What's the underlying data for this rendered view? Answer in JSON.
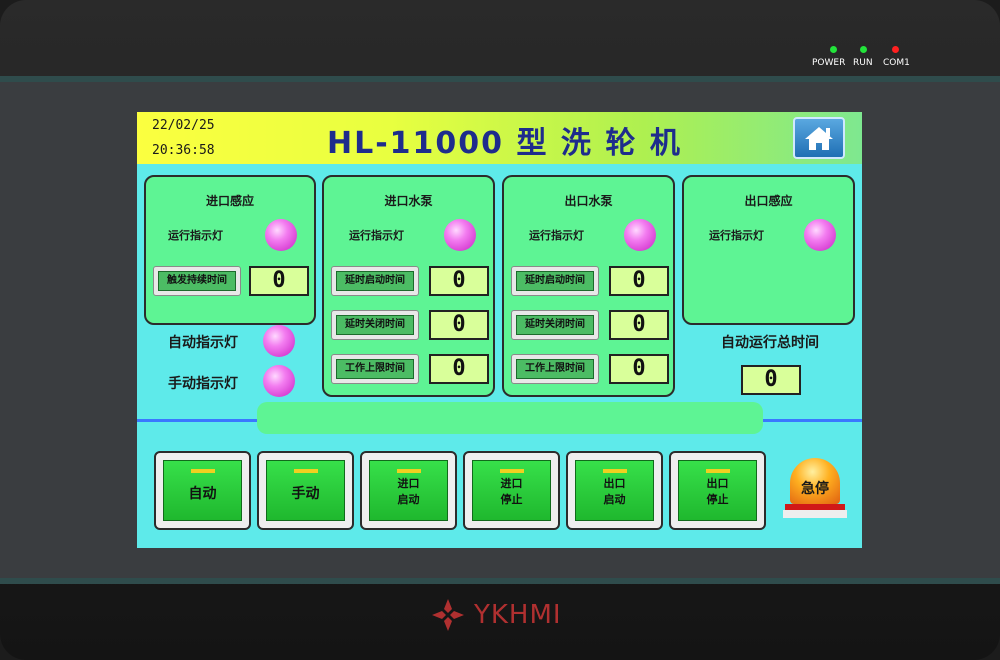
{
  "device": {
    "leds": [
      {
        "label": "POWER",
        "color": "#22e33a"
      },
      {
        "label": "RUN",
        "color": "#22e33a"
      },
      {
        "label": "COM1",
        "color": "#ff2020"
      }
    ],
    "brand": "YKHMI"
  },
  "header": {
    "date": "22/02/25",
    "time": "20:36:58",
    "title": "HL-11000 型 洗 轮 机"
  },
  "panels": [
    {
      "title": "进口感应",
      "lamp_label": "运行指示灯",
      "params": [
        {
          "label": "触发持续时间",
          "value": "0"
        }
      ]
    },
    {
      "title": "进口水泵",
      "lamp_label": "运行指示灯",
      "params": [
        {
          "label": "延时启动时间",
          "value": "0"
        },
        {
          "label": "延时关闭时间",
          "value": "0"
        },
        {
          "label": "工作上限时间",
          "value": "0"
        }
      ]
    },
    {
      "title": "出口水泵",
      "lamp_label": "运行指示灯",
      "params": [
        {
          "label": "延时启动时间",
          "value": "0"
        },
        {
          "label": "延时关闭时间",
          "value": "0"
        },
        {
          "label": "工作上限时间",
          "value": "0"
        }
      ]
    },
    {
      "title": "出口感应",
      "lamp_label": "运行指示灯",
      "params": []
    }
  ],
  "left_status": {
    "auto_label": "自动指示灯",
    "manual_label": "手动指示灯"
  },
  "right_status": {
    "label": "自动运行总时间",
    "value": "0"
  },
  "buttons": [
    {
      "line1": "自动",
      "line2": ""
    },
    {
      "line1": "手动",
      "line2": ""
    },
    {
      "line1": "进口",
      "line2": "启动"
    },
    {
      "line1": "进口",
      "line2": "停止"
    },
    {
      "line1": "出口",
      "line2": "启动"
    },
    {
      "line1": "出口",
      "line2": "停止"
    }
  ],
  "estop": {
    "label": "急停"
  }
}
